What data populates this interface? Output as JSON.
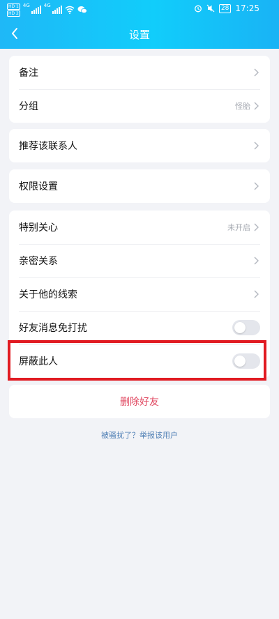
{
  "status_bar": {
    "hd1": "HD 1",
    "hd2": "HD 2",
    "net1": "4G",
    "net2": "4G",
    "battery": "28",
    "time": "17:25"
  },
  "header": {
    "title": "设置"
  },
  "groups": {
    "profile": {
      "remark_label": "备注",
      "remark_value": "",
      "group_label": "分组",
      "group_value": "怪胎"
    },
    "recommend": {
      "label": "推荐该联系人"
    },
    "permission": {
      "label": "权限设置"
    },
    "relation": {
      "special_care_label": "特别关心",
      "special_care_value": "未开启",
      "intimate_label": "亲密关系",
      "clues_label": "关于他的线索",
      "mute_label": "好友消息免打扰",
      "mute_on": false,
      "block_label": "屏蔽此人",
      "block_on": false
    }
  },
  "delete_label": "删除好友",
  "report_link": "被骚扰了？举报该用户",
  "colors": {
    "header_gradient_start": "#1fb8f7",
    "header_gradient_end": "#19b3f5",
    "danger": "#e0465f",
    "link": "#4f7fb5",
    "highlight": "#e11b22"
  }
}
